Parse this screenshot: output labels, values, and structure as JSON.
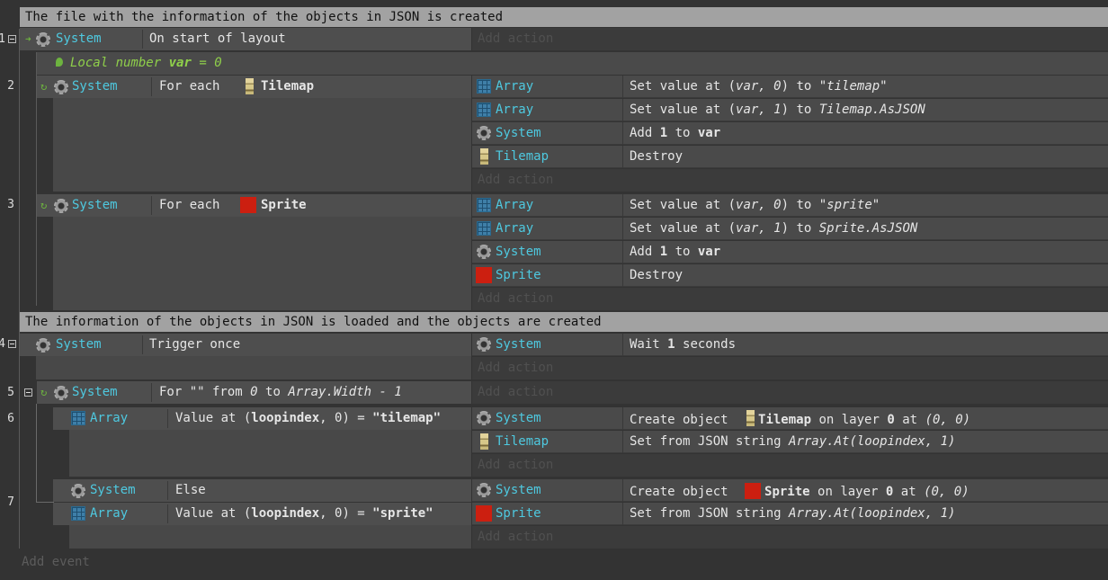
{
  "comments": {
    "c1": "The file with the information of the objects in JSON is created",
    "c2": "The information of the objects in JSON is loaded and the objects are created"
  },
  "event_numbers": [
    "1",
    "2",
    "3",
    "4",
    "5",
    "6",
    "7"
  ],
  "objects": {
    "system": "System",
    "array": "Array",
    "tilemap": "Tilemap",
    "sprite": "Sprite"
  },
  "ev1": {
    "condition": "On start of layout",
    "add_action": "Add action"
  },
  "local_var": {
    "prefix": "Local number",
    "name": "var",
    "eq": "=",
    "value": "0"
  },
  "ev2": {
    "for_each": "For each",
    "actions": [
      {
        "pre": "Set value at (",
        "arg": "var, 0",
        "mid": ") to ",
        "val": "\"tilemap\""
      },
      {
        "pre": "Set value at (",
        "arg": "var, 1",
        "mid": ") to ",
        "val": "Tilemap.AsJSON"
      },
      {
        "pre": "Add ",
        "num": "1",
        "mid": " to ",
        "var": "var"
      },
      {
        "text": "Destroy"
      }
    ],
    "add_action": "Add action"
  },
  "ev3": {
    "for_each": "For each",
    "actions": [
      {
        "pre": "Set value at (",
        "arg": "var, 0",
        "mid": ") to ",
        "val": "\"sprite\""
      },
      {
        "pre": "Set value at (",
        "arg": "var, 1",
        "mid": ") to ",
        "val": "Sprite.AsJSON"
      },
      {
        "pre": "Add ",
        "num": "1",
        "mid": " to ",
        "var": "var"
      },
      {
        "text": "Destroy"
      }
    ],
    "add_action": "Add action"
  },
  "ev4": {
    "condition": "Trigger once",
    "action_pre": "Wait ",
    "action_num": "1",
    "action_post": " seconds",
    "add_action": "Add action"
  },
  "ev5": {
    "pre": "For \"\" from ",
    "from": "0",
    "mid": " to ",
    "to": "Array.Width - 1",
    "add_action": "Add action"
  },
  "ev6": {
    "cond_pre": "Value at (",
    "cond_arg": "loopindex",
    "cond_mid": ", 0) = ",
    "cond_val": "\"tilemap\"",
    "a1_pre": "Create object",
    "a1_mid": "on layer",
    "a1_layer": "0",
    "a1_at": "at",
    "a1_pos": "(0, 0)",
    "a2_pre": "Set from JSON string ",
    "a2_val": "Array.At(loopindex, 1)",
    "add_action": "Add action"
  },
  "ev7": {
    "else": "Else",
    "cond_pre": "Value at (",
    "cond_arg": "loopindex",
    "cond_mid": ", 0) = ",
    "cond_val": "\"sprite\"",
    "a1_pre": "Create object",
    "a1_mid": "on layer",
    "a1_layer": "0",
    "a1_at": "at",
    "a1_pos": "(0, 0)",
    "a2_pre": "Set from JSON string ",
    "a2_val": "Array.At(loopindex, 1)",
    "add_action": "Add action"
  },
  "add_event": "Add event"
}
